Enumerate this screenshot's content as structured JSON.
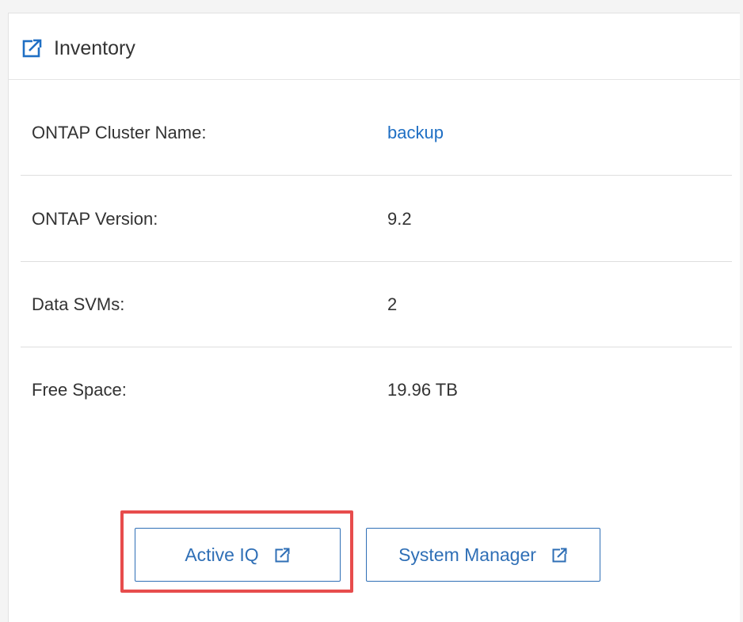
{
  "panel": {
    "title": "Inventory",
    "header_icon": "external-link-icon"
  },
  "rows": [
    {
      "label": "ONTAP Cluster Name:",
      "value": "backup",
      "is_link": true
    },
    {
      "label": "ONTAP Version:",
      "value": "9.2",
      "is_link": false
    },
    {
      "label": "Data SVMs:",
      "value": "2",
      "is_link": false
    },
    {
      "label": "Free Space:",
      "value": "19.96 TB",
      "is_link": false
    }
  ],
  "buttons": {
    "active_iq": {
      "label": "Active IQ",
      "icon": "external-link-icon",
      "highlighted": true
    },
    "system_manager": {
      "label": "System Manager",
      "icon": "external-link-icon"
    }
  },
  "colors": {
    "accent": "#1f6fc4",
    "button_border": "#2f6fb6",
    "highlight": "#e74c4c"
  }
}
